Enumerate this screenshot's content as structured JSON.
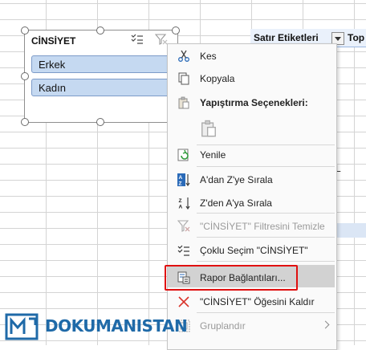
{
  "spreadsheet": {
    "pivot_row_labels": "Satır Etiketleri",
    "pivot_col_partial": "Top",
    "cell_partial": "L"
  },
  "slicer": {
    "title": "CİNSİYET",
    "items": [
      {
        "label": "Erkek",
        "selected": true
      },
      {
        "label": "Kadın",
        "selected": true
      }
    ]
  },
  "context_menu": {
    "items": [
      {
        "label": "Kes",
        "icon": "scissors-icon",
        "enabled": true
      },
      {
        "label": "Kopyala",
        "icon": "copy-icon",
        "enabled": true
      },
      {
        "label": "Yapıştırma Seçenekleri:",
        "icon": "paste-icon",
        "enabled": true,
        "bold": true
      },
      {
        "label": "",
        "icon": "paste-option-icon",
        "enabled": false
      },
      {
        "label": "Yenile",
        "icon": "refresh-icon",
        "enabled": true
      },
      {
        "label": "A'dan Z'ye Sırala",
        "icon": "sort-az-icon",
        "enabled": true
      },
      {
        "label": "Z'den A'ya Sırala",
        "icon": "sort-za-icon",
        "enabled": true
      },
      {
        "label": "\"CİNSİYET\" Filtresini Temizle",
        "icon": "clear-filter-icon",
        "enabled": false
      },
      {
        "label": "Çoklu Seçim \"CİNSİYET\"",
        "icon": "multi-select-icon",
        "enabled": true
      },
      {
        "label": "Rapor Bağlantıları...",
        "icon": "report-connections-icon",
        "enabled": true,
        "highlighted": true
      },
      {
        "label": "\"CİNSİYET\" Öğesini Kaldır",
        "icon": "remove-x-icon",
        "enabled": true
      },
      {
        "label": "Gruplandır",
        "icon": "group-icon",
        "enabled": false,
        "submenu": true
      }
    ]
  },
  "watermark": {
    "text": "DOKUMANISTAN"
  },
  "colors": {
    "slicer_item": "#c5d9f1",
    "highlight_box": "#e01010",
    "menu_bg": "#fafafa",
    "logo_blue": "#1f6aa8"
  }
}
